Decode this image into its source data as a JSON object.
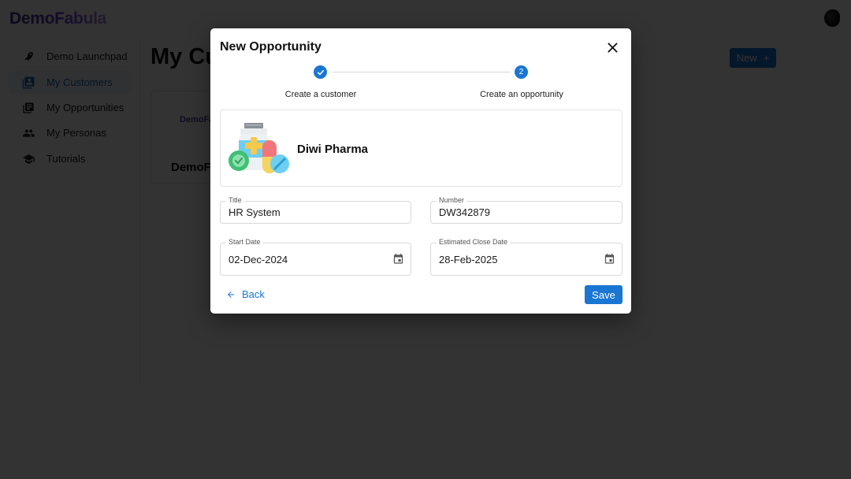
{
  "app": {
    "brand": "DemoFabula",
    "sidebar": {
      "items": [
        {
          "label": "Demo Launchpad",
          "icon": "rocket-icon",
          "active": false
        },
        {
          "label": "My Customers",
          "icon": "contacts-icon",
          "active": true
        },
        {
          "label": "My Opportunities",
          "icon": "library-books-icon",
          "active": false
        },
        {
          "label": "My Personas",
          "icon": "people-icon",
          "active": false
        },
        {
          "label": "Tutorials",
          "icon": "school-icon",
          "active": false
        }
      ]
    },
    "page_title": "My Customers",
    "new_button_label": "New",
    "new_button_icon": "+",
    "customer_card": {
      "logo_text": "DemoFabula",
      "name": "DemoFabula"
    }
  },
  "modal": {
    "title": "New Opportunity",
    "close_icon": "✕",
    "stepper": {
      "steps": [
        {
          "label": "Create a customer",
          "status": "completed",
          "marker": "✓"
        },
        {
          "label": "Create an opportunity",
          "status": "active",
          "marker": "2"
        }
      ]
    },
    "customer": {
      "name": "Diwi Pharma",
      "image": "pharmacy-bottle-pills-illustration"
    },
    "fields": {
      "title": {
        "label": "Title",
        "value": "HR System"
      },
      "number": {
        "label": "Number",
        "value": "DW342879"
      },
      "start_date": {
        "label": "Start Date",
        "value": "02-Dec-2024"
      },
      "close_date": {
        "label": "Estimated Close Date",
        "value": "28-Feb-2025"
      }
    },
    "back_label": "Back",
    "save_label": "Save"
  },
  "colors": {
    "primary": "#1976d2",
    "overlay": "rgba(0,0,0,0.8)",
    "brand_purple": "#6a3bd0"
  }
}
